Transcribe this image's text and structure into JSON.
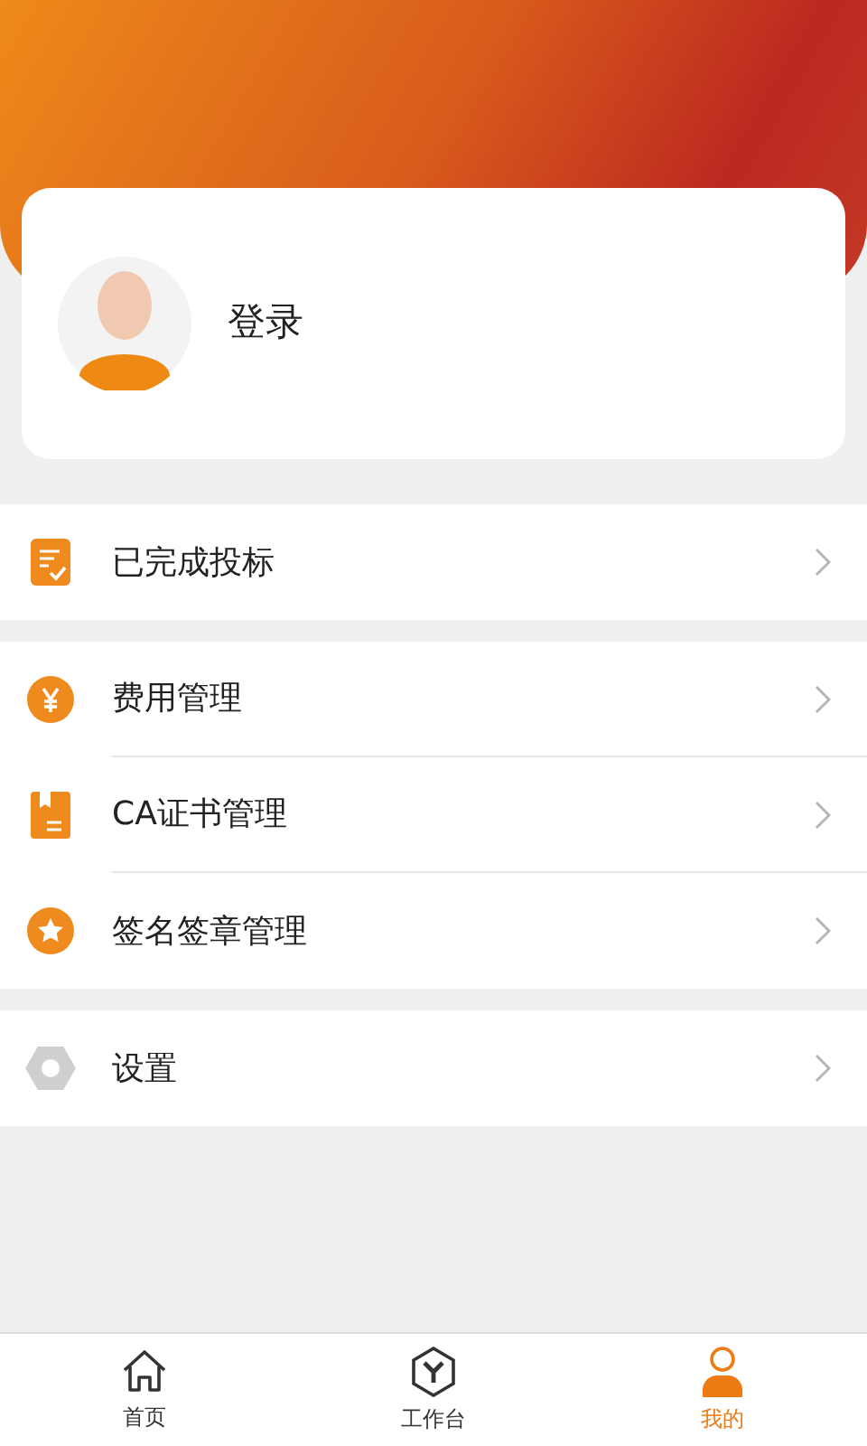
{
  "profile": {
    "login_label": "登录"
  },
  "menu_groups": [
    {
      "items": [
        {
          "kind": "document",
          "label": "已完成投标"
        }
      ]
    },
    {
      "items": [
        {
          "kind": "yen",
          "label": "费用管理"
        },
        {
          "kind": "certificate",
          "label": "CA证书管理"
        },
        {
          "kind": "star",
          "label": "签名签章管理"
        }
      ]
    },
    {
      "items": [
        {
          "kind": "settings",
          "label": "设置"
        }
      ]
    }
  ],
  "tab_bar": [
    {
      "kind": "home",
      "label": "首页",
      "selected": false
    },
    {
      "kind": "workbench",
      "label": "工作台",
      "selected": false
    },
    {
      "kind": "me",
      "label": "我的",
      "selected": true
    }
  ]
}
